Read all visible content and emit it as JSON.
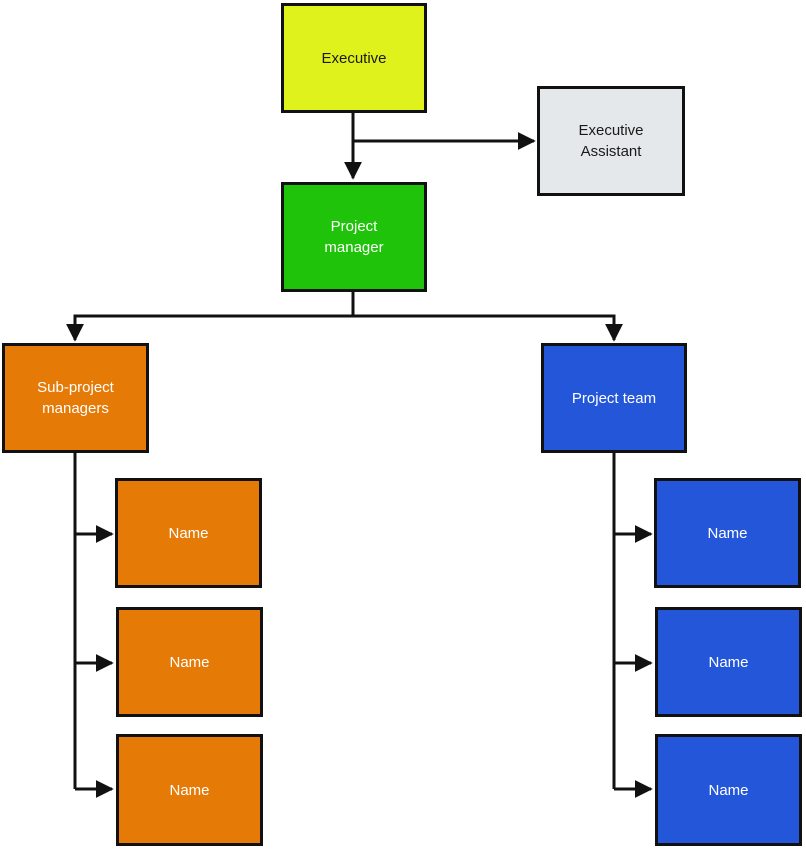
{
  "chart_title": "",
  "colors": {
    "executive": "#dff21c",
    "assistant": "#e5e8eb",
    "manager": "#1ec30a",
    "sub": "#e57a07",
    "team": "#2456da",
    "line": "#111111",
    "dark_text": "#1a1a1a",
    "light_text": "#ffffff"
  },
  "nodes": {
    "executive": {
      "label": "Executive"
    },
    "assistant": {
      "label": "Executive\nAssistant"
    },
    "manager": {
      "label": "Project\nmanager"
    },
    "sub_managers": {
      "label": "Sub-project\nmanagers"
    },
    "team": {
      "label": "Project team"
    },
    "sub_names": [
      {
        "label": "Name"
      },
      {
        "label": "Name"
      },
      {
        "label": "Name"
      }
    ],
    "team_names": [
      {
        "label": "Name"
      },
      {
        "label": "Name"
      },
      {
        "label": "Name"
      }
    ]
  }
}
